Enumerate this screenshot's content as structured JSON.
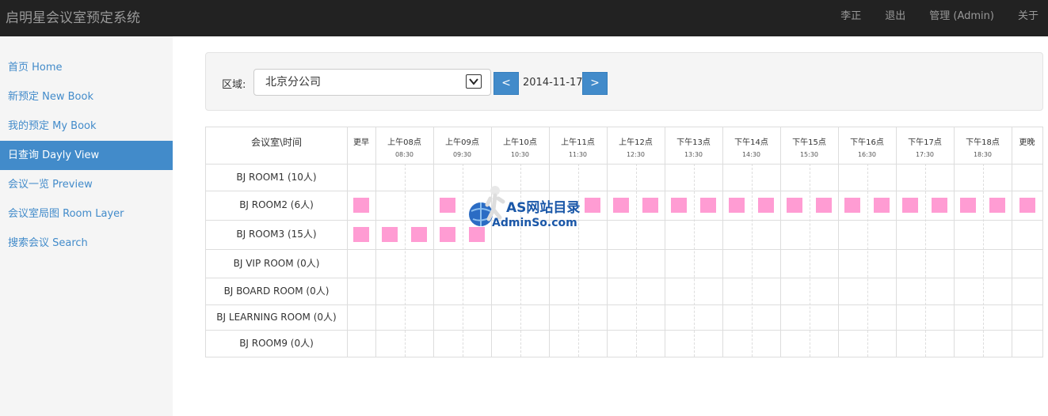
{
  "header": {
    "brand": "启明星会议室预定系统",
    "nav": [
      "李正",
      "退出",
      "管理 (Admin)",
      "关于"
    ]
  },
  "sidebar": {
    "items": [
      {
        "label": "首页 Home",
        "active": false
      },
      {
        "label": "新预定 New Book",
        "active": false
      },
      {
        "label": "我的预定 My Book",
        "active": false
      },
      {
        "label": "日查询 Dayly View",
        "active": true
      },
      {
        "label": "会议一览 Preview",
        "active": false
      },
      {
        "label": "会议室局图 Room Layer",
        "active": false
      },
      {
        "label": "搜索会议 Search",
        "active": false
      }
    ]
  },
  "filter": {
    "area_label": "区域:",
    "area_value": "北京分公司",
    "prev_label": "<",
    "date": "2014-11-17",
    "next_label": ">"
  },
  "schedule": {
    "corner": "会议室\\时间",
    "early": "更早",
    "late": "更晚",
    "hours": [
      {
        "label": "上午08点",
        "half": "08:30"
      },
      {
        "label": "上午09点",
        "half": "09:30"
      },
      {
        "label": "上午10点",
        "half": "10:30"
      },
      {
        "label": "上午11点",
        "half": "11:30"
      },
      {
        "label": "上午12点",
        "half": "12:30"
      },
      {
        "label": "下午13点",
        "half": "13:30"
      },
      {
        "label": "下午14点",
        "half": "14:30"
      },
      {
        "label": "下午15点",
        "half": "15:30"
      },
      {
        "label": "下午16点",
        "half": "16:30"
      },
      {
        "label": "下午17点",
        "half": "17:30"
      },
      {
        "label": "下午18点",
        "half": "18:30"
      }
    ],
    "rooms": [
      {
        "name": "BJ ROOM1 (10人)",
        "booked": []
      },
      {
        "name": "BJ ROOM2 (6人)",
        "booked": [
          0,
          3,
          8,
          9,
          10,
          11,
          12,
          13,
          14,
          15,
          16,
          17,
          18,
          19,
          20,
          21,
          22,
          23
        ]
      },
      {
        "name": "BJ ROOM3 (15人)",
        "booked": [
          0,
          1,
          2,
          3,
          4
        ]
      },
      {
        "name": "BJ VIP ROOM (0人)",
        "booked": []
      },
      {
        "name": "BJ BOARD ROOM (0人)",
        "booked": []
      },
      {
        "name": "BJ LEARNING ROOM (0人)",
        "booked": []
      },
      {
        "name": "BJ ROOM9 (0人)",
        "booked": []
      }
    ],
    "booked_color": "#ff9cd3"
  },
  "watermark": {
    "line1": "AS网站目录",
    "line2": "AdminSo.com"
  }
}
